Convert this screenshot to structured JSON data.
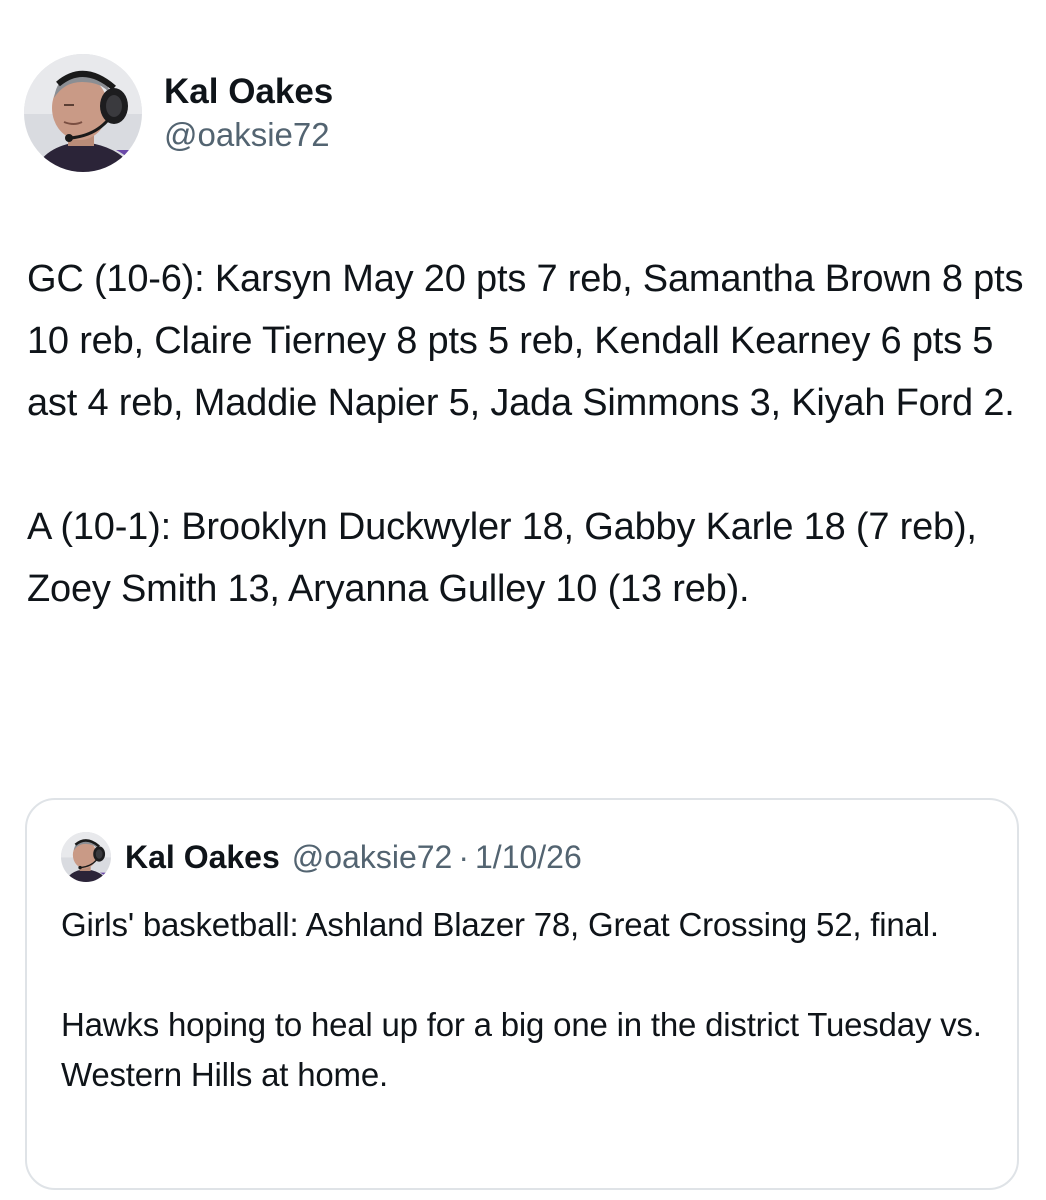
{
  "author": {
    "display_name": "Kal Oakes",
    "handle": "@oaksie72",
    "avatar_icon": "profile-photo-man-with-headset"
  },
  "post": {
    "text": "GC (10-6): Karsyn May 20 pts 7 reb, Samantha Brown 8 pts 10 reb, Claire Tierney 8 pts 5 reb, Kendall Kearney 6 pts 5 ast 4 reb, Maddie Napier 5, Jada Simmons 3, Kiyah Ford 2.\n\nA (10-1): Brooklyn Duckwyler 18, Gabby Karle 18 (7 reb), Zoey Smith 13, Aryanna Gulley 10 (13 reb)."
  },
  "quoted_post": {
    "display_name": "Kal Oakes",
    "handle": "@oaksie72",
    "separator": "·",
    "date": "1/10/26",
    "text": "Girls' basketball: Ashland Blazer 78, Great Crossing 52, final.\n\nHawks hoping to heal up for a big one in the district Tuesday vs. Western Hills at home."
  },
  "colors": {
    "text_primary": "#0f1419",
    "text_secondary": "#536471",
    "border": "#dfe3e7"
  }
}
